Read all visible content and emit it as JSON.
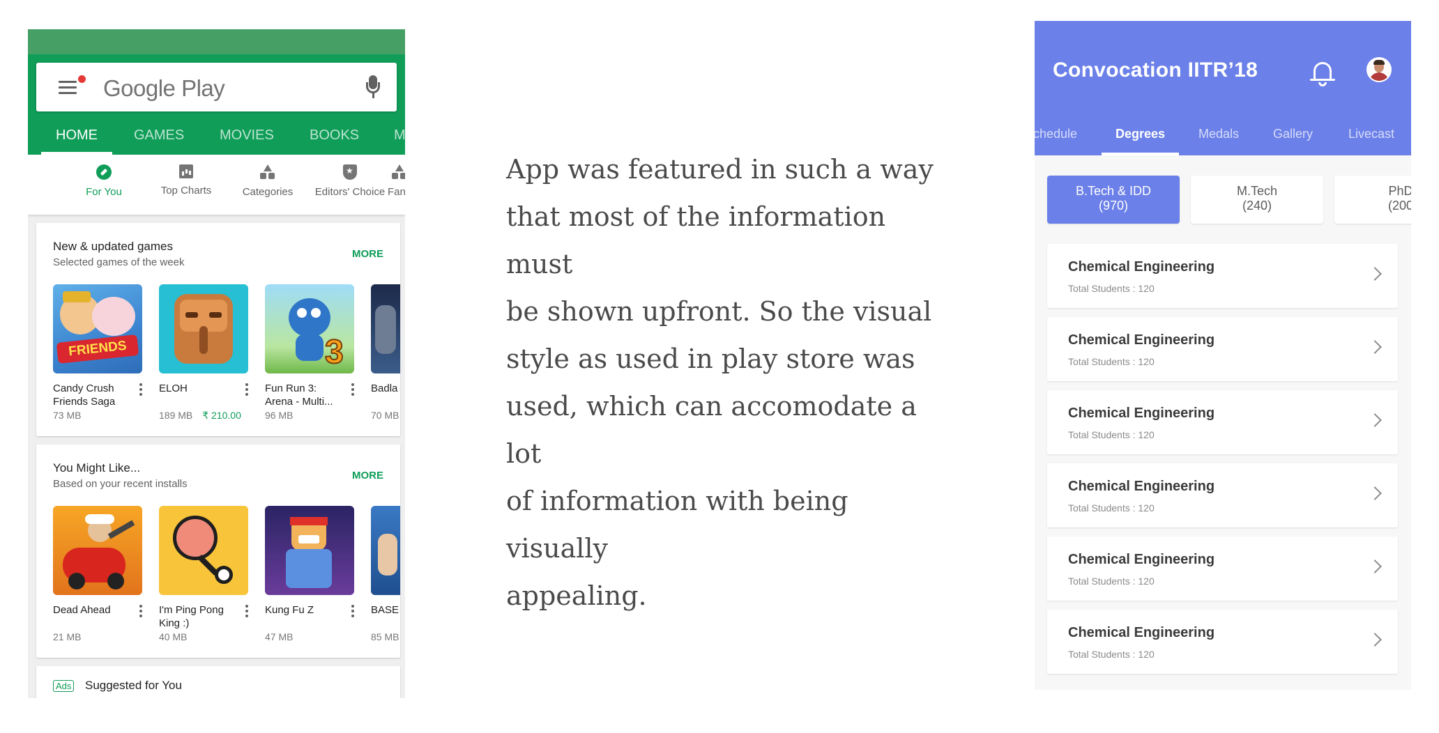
{
  "play": {
    "search_logo": "Google Play",
    "tabs": [
      "HOME",
      "GAMES",
      "MOVIES",
      "BOOKS",
      "M"
    ],
    "subnav": [
      "For You",
      "Top Charts",
      "Categories",
      "Editors' Choice",
      "Fan"
    ],
    "card1": {
      "title": "New & updated games",
      "subtitle": "Selected games of the week",
      "more": "MORE",
      "apps": [
        {
          "name": "Candy Crush Friends Saga",
          "size": "73 MB",
          "price": ""
        },
        {
          "name": "ELOH",
          "size": "189 MB",
          "price": "₹ 210.00"
        },
        {
          "name": "Fun Run 3: Arena - Multi...",
          "size": "96 MB",
          "price": ""
        },
        {
          "name": "Badla",
          "size": "70 MB",
          "price": ""
        }
      ]
    },
    "card2": {
      "title": "You Might Like...",
      "subtitle": "Based on your recent installs",
      "more": "MORE",
      "apps": [
        {
          "name": "Dead Ahead",
          "size": "21 MB"
        },
        {
          "name": "I'm Ping Pong King :)",
          "size": "40 MB"
        },
        {
          "name": "Kung Fu Z",
          "size": "47 MB"
        },
        {
          "name": "BASE",
          "size": "85 MB"
        }
      ]
    },
    "ads": {
      "tag": "Ads",
      "title": "Suggested for You"
    },
    "icon_art": {
      "friends": "FRIENDS",
      "run_badge": "3"
    }
  },
  "blurb": {
    "lines": [
      "App was featured in such a way",
      "that most of the information must",
      "be shown upfront. So the visual",
      "style as used in play store was",
      "used, which can accomodate a lot",
      "of information with being visually",
      "appealing."
    ]
  },
  "convocation": {
    "title": "Convocation IITR’18",
    "tabs": [
      "chedule",
      "Degrees",
      "Medals",
      "Gallery",
      "Livecast"
    ],
    "active_tab": "Degrees",
    "chips": [
      {
        "label": "B.Tech & IDD",
        "count": "(970)"
      },
      {
        "label": "M.Tech",
        "count": "(240)"
      },
      {
        "label": "PhD",
        "count": "(200"
      }
    ],
    "departments": [
      {
        "name": "Chemical Engineering",
        "students": "Total Students : 120"
      },
      {
        "name": "Chemical Engineering",
        "students": "Total Students : 120"
      },
      {
        "name": "Chemical Engineering",
        "students": "Total Students : 120"
      },
      {
        "name": "Chemical Engineering",
        "students": "Total Students : 120"
      },
      {
        "name": "Chemical Engineering",
        "students": "Total Students : 120"
      },
      {
        "name": "Chemical Engineering",
        "students": "Total Students : 120"
      }
    ]
  },
  "colors": {
    "play_green": "#0f9d58",
    "play_status": "#46a065",
    "convocation_accent": "#6b80e8",
    "body_text": "#4a4a4a"
  }
}
